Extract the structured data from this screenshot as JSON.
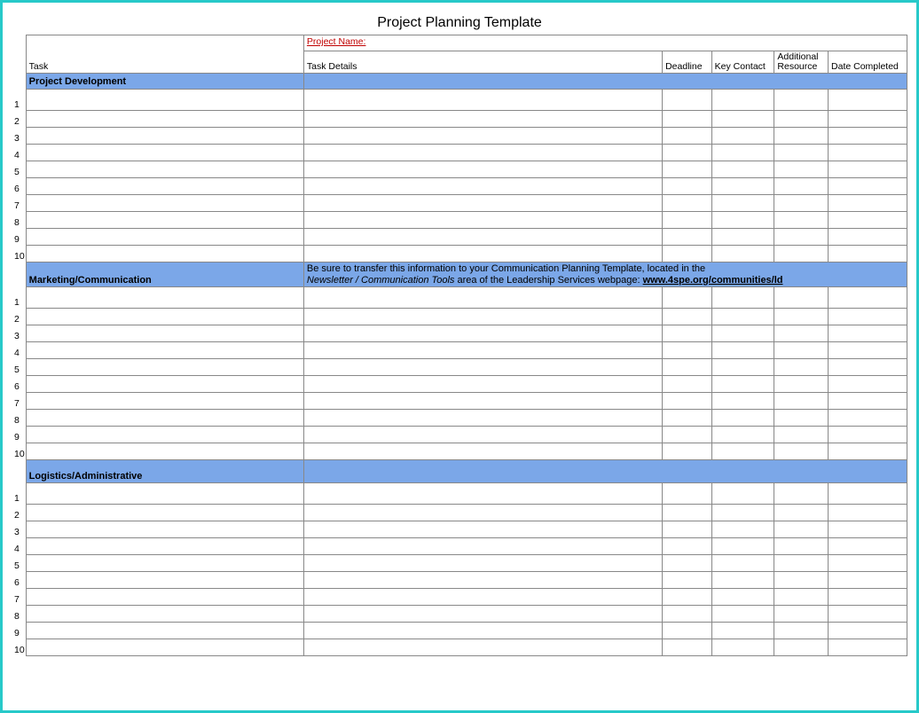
{
  "title": "Project Planning Template",
  "headers": {
    "project_name_label": "Project Name:",
    "task": "Task",
    "task_details": "Task Details",
    "deadline": "Deadline",
    "key_contact": "Key Contact",
    "additional_resource": "Additional Resource",
    "date_completed": "Date Completed"
  },
  "sections": [
    {
      "name": "Project Development",
      "note": "",
      "row_count": 10
    },
    {
      "name": "Marketing/Communication",
      "note_line1": "Be sure to transfer this information to your Communication Planning Template, located in the",
      "note_line2_italic": "Newsletter / Communication Tools",
      "note_line2_plain": " area of the Leadership Services webpage: ",
      "note_line2_url": "www.4spe.org/communities/ld",
      "row_count": 10
    },
    {
      "name": "Logistics/Administrative",
      "note": "",
      "row_count": 10
    }
  ],
  "row_numbers": [
    "1",
    "2",
    "3",
    "4",
    "5",
    "6",
    "7",
    "8",
    "9",
    "10"
  ]
}
